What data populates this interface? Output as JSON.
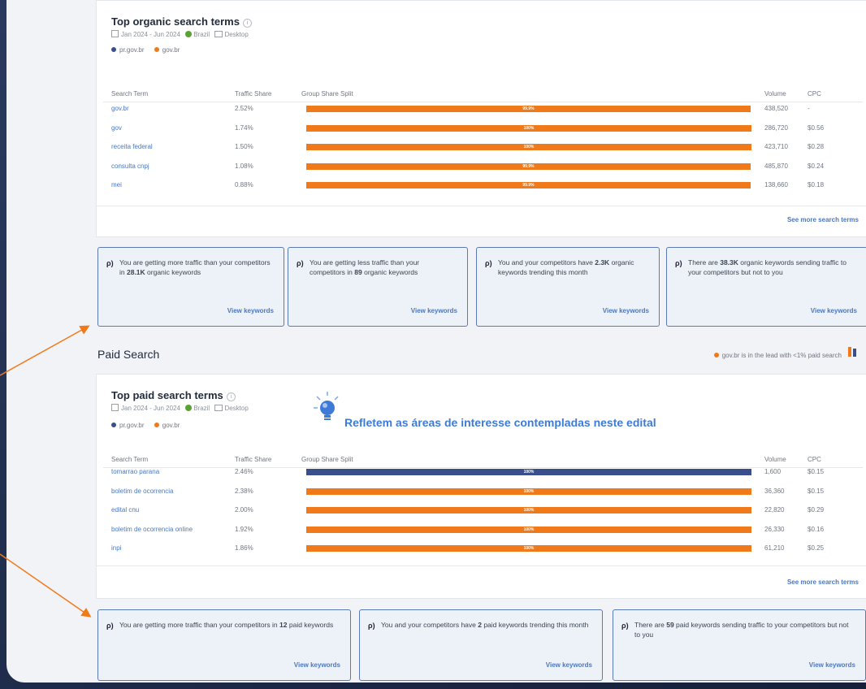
{
  "organic": {
    "title": "Top organic search terms",
    "info_icon": "info-icon",
    "date_range": "Jan 2024 - Jun 2024",
    "country": "Brazil",
    "device": "Desktop",
    "legend": [
      {
        "label": "pr.gov.br",
        "color": "#3b4e8c"
      },
      {
        "label": "gov.br",
        "color": "#f07a1a"
      }
    ],
    "columns": {
      "term": "Search Term",
      "share": "Traffic Share",
      "split": "Group Share Split",
      "volume": "Volume",
      "cpc": "CPC"
    },
    "rows": [
      {
        "term": "gov.br",
        "share": "2.52%",
        "split_label": "99.9%",
        "split_pct": 99.9,
        "volume": "438,520",
        "cpc": "-"
      },
      {
        "term": "gov",
        "share": "1.74%",
        "split_label": "100%",
        "split_pct": 100,
        "volume": "286,720",
        "cpc": "$0.56"
      },
      {
        "term": "receita federal",
        "share": "1.50%",
        "split_label": "100%",
        "split_pct": 100,
        "volume": "423,710",
        "cpc": "$0.28"
      },
      {
        "term": "consulta cnpj",
        "share": "1.08%",
        "split_label": "99.9%",
        "split_pct": 99.9,
        "volume": "485,870",
        "cpc": "$0.24"
      },
      {
        "term": "mei",
        "share": "0.88%",
        "split_label": "99.9%",
        "split_pct": 99.9,
        "volume": "138,660",
        "cpc": "$0.18"
      }
    ],
    "see_more": "See more search terms"
  },
  "organic_insights": [
    {
      "text_a": "You are getting more traffic than your competitors in ",
      "bold": "28.1K",
      "text_b": " organic keywords",
      "link": "View keywords"
    },
    {
      "text_a": "You are getting less traffic than your competitors in ",
      "bold": "89",
      "text_b": " organic keywords",
      "link": "View keywords"
    },
    {
      "text_a": "You and your competitors have ",
      "bold": "2.3K",
      "text_b": " organic keywords trending this month",
      "link": "View keywords"
    },
    {
      "text_a": "There are ",
      "bold": "38.3K",
      "text_b": " organic keywords sending traffic to your competitors but not to you",
      "link": "View keywords"
    }
  ],
  "paid_section": {
    "title": "Paid Search",
    "lead_note": "gov.br is in the lead with <1% paid search",
    "lead_color": "#f07a1a"
  },
  "paid": {
    "title": "Top paid search terms",
    "info_icon": "info-icon",
    "date_range": "Jan 2024 - Jun 2024",
    "country": "Brazil",
    "device": "Desktop",
    "legend": [
      {
        "label": "pr.gov.br",
        "color": "#3b4e8c"
      },
      {
        "label": "gov.br",
        "color": "#f07a1a"
      }
    ],
    "columns": {
      "term": "Search Term",
      "share": "Traffic Share",
      "split": "Group Share Split",
      "volume": "Volume",
      "cpc": "CPC"
    },
    "rows": [
      {
        "term": "tomarrao parana",
        "share": "2.46%",
        "split_label": "100%",
        "split_pct": 100,
        "bar_color": "blue",
        "volume": "1,600",
        "cpc": "$0.15"
      },
      {
        "term": "boletim de ocorrencia",
        "share": "2.38%",
        "split_label": "100%",
        "split_pct": 100,
        "bar_color": "orange",
        "volume": "36,360",
        "cpc": "$0.15"
      },
      {
        "term": "edital cnu",
        "share": "2.00%",
        "split_label": "100%",
        "split_pct": 100,
        "bar_color": "orange",
        "volume": "22,820",
        "cpc": "$0.29"
      },
      {
        "term": "boletim de ocorrencia online",
        "share": "1.92%",
        "split_label": "100%",
        "split_pct": 100,
        "bar_color": "orange",
        "volume": "26,330",
        "cpc": "$0.16"
      },
      {
        "term": "inpi",
        "share": "1.86%",
        "split_label": "100%",
        "split_pct": 100,
        "bar_color": "orange",
        "volume": "61,210",
        "cpc": "$0.25"
      }
    ],
    "see_more": "See more search terms"
  },
  "paid_insights": [
    {
      "text_a": "You are getting more traffic than your competitors in ",
      "bold": "12",
      "text_b": " paid keywords",
      "link": "View keywords"
    },
    {
      "text_a": "You and your competitors have ",
      "bold": "2",
      "text_b": " paid keywords trending this month",
      "link": "View keywords"
    },
    {
      "text_a": "There are ",
      "bold": "59",
      "text_b": " paid keywords sending traffic to your competitors but not to you",
      "link": "View keywords"
    }
  ],
  "annotation": {
    "text": "Refletem as áreas de interesse contempladas neste edital",
    "icon": "lightbulb-icon",
    "color": "#3d7bd6",
    "arrow_color": "#f07a1a"
  }
}
